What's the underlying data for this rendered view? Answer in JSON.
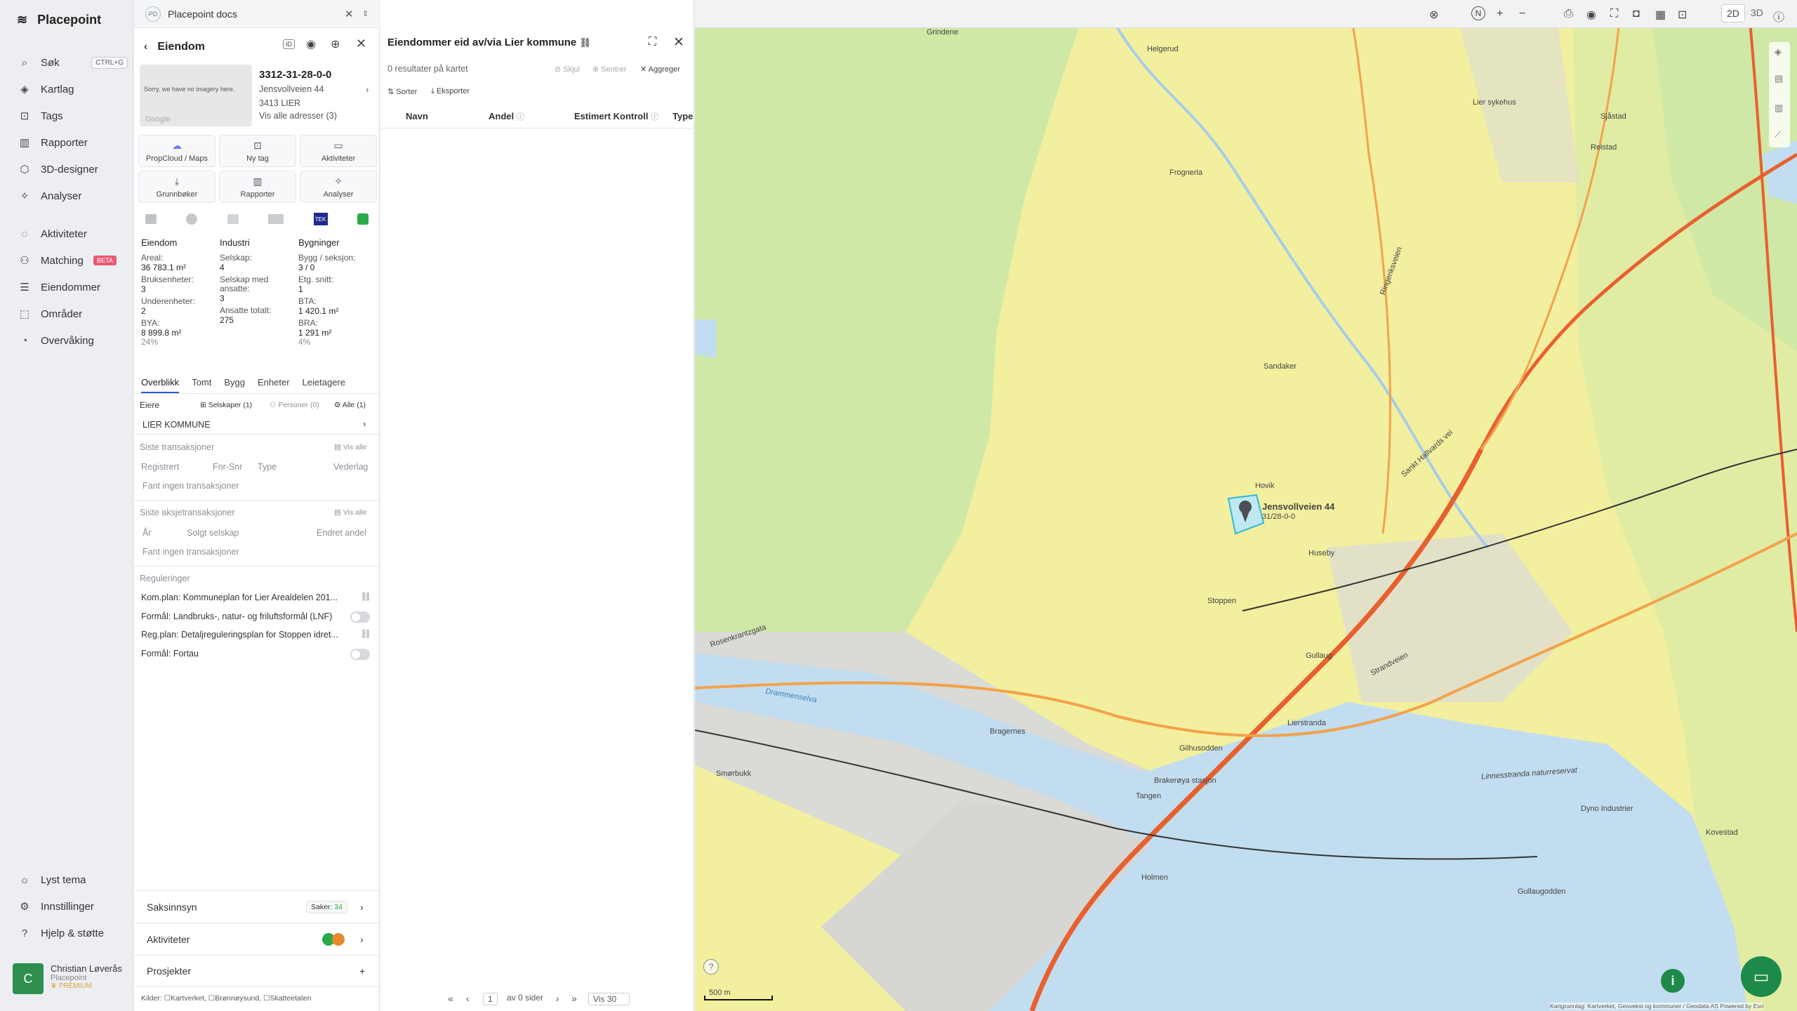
{
  "nav": {
    "brand": "Placepoint",
    "items": [
      {
        "label": "Søk",
        "shortcut": "CTRL+G"
      },
      {
        "label": "Kartlag"
      },
      {
        "label": "Tags"
      },
      {
        "label": "Rapporter"
      },
      {
        "label": "3D-designer"
      },
      {
        "label": "Analyser"
      },
      {
        "label": "Aktiviteter"
      },
      {
        "label": "Matching",
        "badge": "BETA"
      },
      {
        "label": "Eiendommer"
      },
      {
        "label": "Områder"
      },
      {
        "label": "Overvåking"
      }
    ],
    "bottom": [
      {
        "label": "Lyst tema"
      },
      {
        "label": "Innstillinger"
      },
      {
        "label": "Hjelp & støtte"
      }
    ],
    "user": {
      "initial": "C",
      "name": "Christian Løverås",
      "org": "Placepoint",
      "plan": "PREMIUM"
    }
  },
  "docs_tab": {
    "badge": "PD",
    "title": "Placepoint docs"
  },
  "property": {
    "header": "Eiendom",
    "no_imagery": "Sorry, we have no imagery here.",
    "google": "Google",
    "id": "3312-31-28-0-0",
    "address": "Jensvollveien 44",
    "postal": "3413 LIER",
    "all_addresses": "Vis alle adresser (3)",
    "actions": [
      {
        "label": "PropCloud / Maps",
        "icon": "cloud-icon"
      },
      {
        "label": "Ny tag",
        "icon": "bookmark-icon"
      },
      {
        "label": "Aktiviteter",
        "icon": "chat-icon"
      },
      {
        "label": "Grunnbøker",
        "icon": "download-icon"
      },
      {
        "label": "Rapporter",
        "icon": "chart-icon"
      },
      {
        "label": "Analyser",
        "icon": "bulb-icon"
      }
    ],
    "cols": [
      {
        "title": "Eiendom",
        "stats": [
          [
            "Areal:",
            "36 783.1 m²"
          ],
          [
            "Bruksenheter:",
            "3"
          ],
          [
            "Underenheter:",
            "2"
          ],
          [
            "BYA:",
            "8 899.8 m²"
          ],
          [
            "",
            "24%"
          ]
        ]
      },
      {
        "title": "Industri",
        "stats": [
          [
            "Selskap:",
            "4"
          ],
          [
            "Selskap med ansatte:",
            "3"
          ],
          [
            "Ansatte totalt:",
            "275"
          ]
        ]
      },
      {
        "title": "Bygninger",
        "stats": [
          [
            "Bygg / seksjon:",
            "3 / 0"
          ],
          [
            "Etg. snitt:",
            "1"
          ],
          [
            "BTA:",
            "1 420.1 m²"
          ],
          [
            "BRA:",
            "1 291 m²"
          ],
          [
            "",
            "4%"
          ]
        ]
      }
    ],
    "tabs": [
      "Overblikk",
      "Tomt",
      "Bygg",
      "Enheter",
      "Leietagere"
    ],
    "owners_label": "Eiere",
    "owner_filters": [
      "Selskaper (1)",
      "Personer (0)",
      "Alle (1)"
    ],
    "owner": "LIER KOMMUNE",
    "transactions": {
      "title": "Siste transaksjoner",
      "show_all": "Vis alle",
      "cols": [
        "Registrert",
        "Fnr-Snr",
        "Type",
        "Vederlag"
      ],
      "empty": "Fant ingen transaksjoner"
    },
    "share_tx": {
      "title": "Siste aksjetransaksjoner",
      "show_all": "Vis alle",
      "cols": [
        "År",
        "Solgt selskap",
        "Endret andel"
      ],
      "empty": "Fant ingen transaksjoner"
    },
    "regulations": {
      "title": "Reguleringer",
      "items": [
        "Kom.plan: Kommuneplan for Lier Arealdelen 201...",
        "Formål: Landbruks-, natur- og friluftsformål (LNF)",
        "Reg.plan: Detaljreguleringsplan for Stoppen idret...",
        "Formål: Fortau"
      ]
    },
    "accordions": [
      {
        "label": "Saksinnsyn",
        "badge": "Saker:",
        "count": "34"
      },
      {
        "label": "Aktiviteter"
      },
      {
        "label": "Prosjekter"
      }
    ],
    "sources": "Kilder: ☐Kartverket, ☐Brønnøysund, ☐Skatteetaten"
  },
  "results": {
    "title": "Eiendommer eid av/via Lier kommune",
    "summary": "0 resultater på kartet",
    "actions": [
      "Skjul",
      "Sentrer",
      "Aggreger"
    ],
    "tools": [
      "Sorter",
      "Eksporter"
    ],
    "columns": [
      "Navn",
      "Andel",
      "Estimert Kontroll",
      "Type"
    ],
    "pager": {
      "page": "1",
      "of": "av 0 sider",
      "per_page": "Vis 30"
    }
  },
  "mapbar": {
    "mode_2d": "2D",
    "mode_3d": "3D",
    "north": "N"
  },
  "map": {
    "scale": "500 m",
    "attribution": "Kartgrunnlag: Kartverket, Geovekst og kommuner / Geodata AS  Powered by Esri",
    "marker_label": "Jensvollveien 44",
    "marker_sub": "31/28-0-0",
    "places": [
      "Grindene",
      "Helgerud",
      "Huseby",
      "Gullaug",
      "Drammenselva",
      "Holmen",
      "Gilhusodden",
      "Lierstranda",
      "Hovik",
      "Stoppen",
      "Sandaker",
      "Frognerla",
      "Strandveien",
      "Tangen",
      "Brakerøya stasjon",
      "Rosenkrantzgata",
      "Sankt Hallvards vei",
      "Ringeriksveien",
      "Linnesstranda naturreservat",
      "Lier sykehus",
      "Dyno Industrier",
      "Bragernes",
      "Smørbukk",
      "Reistad",
      "Sjåstad",
      "Gullaugodden",
      "Kovestad"
    ]
  },
  "colors": {
    "accent": "#2a5bd7",
    "map_yellow": "#f2ef9f",
    "map_green": "#cfe8a6",
    "water": "#c2ddf0",
    "road": "#e8602f"
  }
}
